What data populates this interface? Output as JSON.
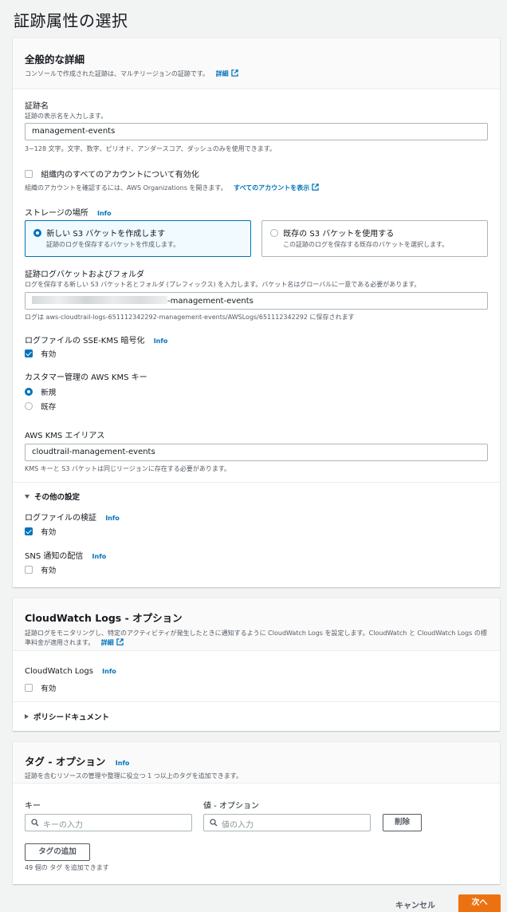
{
  "page_title": "証跡属性の選択",
  "general": {
    "title": "全般的な詳細",
    "desc": "コンソールで作成された証跡は、マルチリージョンの証跡です。",
    "desc_link": "詳細",
    "trail_name_label": "証跡名",
    "trail_name_desc": "証跡の表示名を入力します。",
    "trail_name_value": "management-events",
    "trail_name_hint": "3~128 文字。文字、数字、ピリオド、アンダースコア、ダッシュのみを使用できます。",
    "org_label": "組織内のすべてのアカウントについて有効化",
    "org_desc": "組織のアカウントを確認するには、AWS Organizations を開きます。",
    "org_link": "すべてのアカウントを表示",
    "storage_label": "ストレージの場所",
    "info": "Info",
    "storage_new_title": "新しい S3 バケットを作成します",
    "storage_new_desc": "証跡のログを保存するバケットを作成します。",
    "storage_existing_title": "既存の S3 バケットを使用する",
    "storage_existing_desc": "この証跡のログを保存する既存のバケットを選択します。",
    "bucket_label": "証跡ログバケットおよびフォルダ",
    "bucket_desc": "ログを保存する新しい S3 バケット名とフォルダ (プレフィックス) を入力します。バケット名はグローバルに一意である必要があります。",
    "bucket_value_suffix": "-management-events",
    "bucket_hint": "ログは aws-cloudtrail-logs-651112342292-management-events/AWSLogs/651112342292 に保存されます",
    "sse_label": "ログファイルの SSE-KMS 暗号化",
    "enabled": "有効",
    "kms_label": "カスタマー管理の AWS KMS キー",
    "kms_new": "新規",
    "kms_existing": "既存",
    "alias_label": "AWS KMS エイリアス",
    "alias_value": "cloudtrail-management-events",
    "alias_hint": "KMS キーと S3 バケットは同じリージョンに存在する必要があります。",
    "other_settings": "その他の設定",
    "validation_label": "ログファイルの検証",
    "sns_label": "SNS 通知の配信"
  },
  "cloudwatch": {
    "title": "CloudWatch Logs - オプション",
    "desc": "証跡ログをモニタリングし、特定のアクティビティが発生したときに通知するように CloudWatch Logs を設定します。CloudWatch と CloudWatch Logs の標準料金が適用されます。",
    "desc_link": "詳細",
    "cw_label": "CloudWatch Logs",
    "policy_doc": "ポリシードキュメント"
  },
  "tags": {
    "title": "タグ - オプション",
    "desc": "証跡を含むリソースの管理や整理に役立つ 1 つ以上のタグを追加できます。",
    "key_label": "キー",
    "value_label": "値 - オプション",
    "key_placeholder": "キーの入力",
    "value_placeholder": "値の入力",
    "remove": "削除",
    "add_tag": "タグの追加",
    "limit_hint": "49 個の タグ を追加できます"
  },
  "footer": {
    "cancel": "キャンセル",
    "next": "次へ"
  },
  "colors": {
    "accent": "#0073bb",
    "primary_button": "#ec7211"
  }
}
